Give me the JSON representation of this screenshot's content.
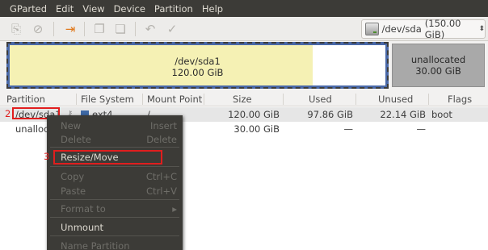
{
  "menubar": [
    "GParted",
    "Edit",
    "View",
    "Device",
    "Partition",
    "Help"
  ],
  "device_selector": {
    "device": "/dev/sda",
    "size": "(150.00 GiB)"
  },
  "disk_map": {
    "partition": {
      "name": "/dev/sda1",
      "size": "120.00 GiB",
      "used_fraction": 0.806
    },
    "unallocated": {
      "name": "unallocated",
      "size": "30.00 GiB"
    }
  },
  "table": {
    "headers": [
      "Partition",
      "File System",
      "Mount Point",
      "Size",
      "Used",
      "Unused",
      "Flags"
    ],
    "rows": [
      {
        "partition": "/dev/sda1",
        "filesystem": "ext4",
        "mount": "/",
        "size": "120.00 GiB",
        "used": "97.86 GiB",
        "unused": "22.14 GiB",
        "flags": "boot"
      },
      {
        "partition": "unallocated",
        "filesystem": "",
        "mount": "",
        "size": "30.00 GiB",
        "used": "—",
        "unused": "—",
        "flags": ""
      }
    ]
  },
  "context_menu": {
    "items": [
      {
        "label": "New",
        "accel": "Insert",
        "enabled": false
      },
      {
        "label": "Delete",
        "accel": "Delete",
        "enabled": false
      },
      {
        "label": "Resize/Move",
        "accel": "",
        "enabled": true
      },
      {
        "label": "Copy",
        "accel": "Ctrl+C",
        "enabled": false
      },
      {
        "label": "Paste",
        "accel": "Ctrl+V",
        "enabled": false
      },
      {
        "label": "Format to",
        "accel": "▸",
        "enabled": false
      },
      {
        "label": "Unmount",
        "accel": "",
        "enabled": true
      },
      {
        "label": "Name Partition",
        "accel": "",
        "enabled": false
      }
    ]
  },
  "annotations": {
    "step_partition": "2",
    "step_resize": "3"
  },
  "colors": {
    "menubar_bg": "#3c3b37",
    "ext4": "#3f6aa6",
    "used": "#f5f1b4",
    "unallocated": "#a9a9a9",
    "highlight": "#e01e1e"
  }
}
